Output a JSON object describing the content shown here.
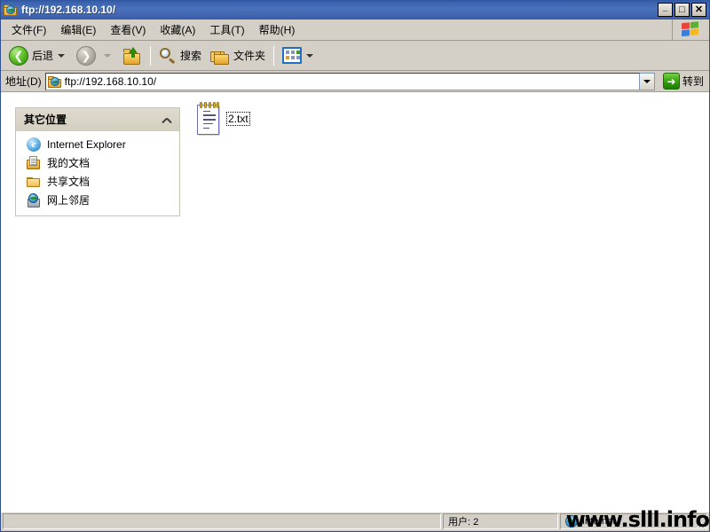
{
  "window": {
    "title": "ftp://192.168.10.10/",
    "title_icon": "ftp-folder-globe-icon",
    "controls": {
      "minimize": "_",
      "maximize": "□",
      "close": "✕"
    }
  },
  "menubar": {
    "items": [
      {
        "label": "文件(F)",
        "name": "menu-file"
      },
      {
        "label": "编辑(E)",
        "name": "menu-edit"
      },
      {
        "label": "查看(V)",
        "name": "menu-view"
      },
      {
        "label": "收藏(A)",
        "name": "menu-favorites"
      },
      {
        "label": "工具(T)",
        "name": "menu-tools"
      },
      {
        "label": "帮助(H)",
        "name": "menu-help"
      }
    ],
    "logo": "windows-flag-logo"
  },
  "toolbar": {
    "back_label": "后退",
    "forward_label": "",
    "up_label": "",
    "search_label": "搜索",
    "folders_label": "文件夹",
    "views_label": ""
  },
  "addressbar": {
    "label": "地址(D)",
    "value": "ftp://192.168.10.10/",
    "placeholder": "",
    "go_label": "转到"
  },
  "sidebar": {
    "panel_title": "其它位置",
    "items": [
      {
        "label": "Internet Explorer",
        "icon": "internet-explorer-icon"
      },
      {
        "label": "我的文档",
        "icon": "my-documents-icon"
      },
      {
        "label": "共享文档",
        "icon": "shared-documents-icon"
      },
      {
        "label": "网上邻居",
        "icon": "my-network-places-icon"
      }
    ]
  },
  "content": {
    "files": [
      {
        "name": "2.txt",
        "icon": "notepad-text-file-icon",
        "focused": true
      }
    ]
  },
  "statusbar": {
    "main": "",
    "users": "用户: 2",
    "zone": "Internet",
    "zone_icon": "internet-zone-globe-icon"
  },
  "watermark": {
    "text": "www.slll.info"
  },
  "colors": {
    "titlebar_start": "#2f55a0",
    "titlebar_end": "#3a5ca8",
    "chrome": "#d4d0c8",
    "panel_header": "#d4d0c0",
    "panel_border": "#c8c4b4",
    "content_bg": "#ffffff",
    "go_green": "#35a40d",
    "back_green": "#62c12c"
  }
}
